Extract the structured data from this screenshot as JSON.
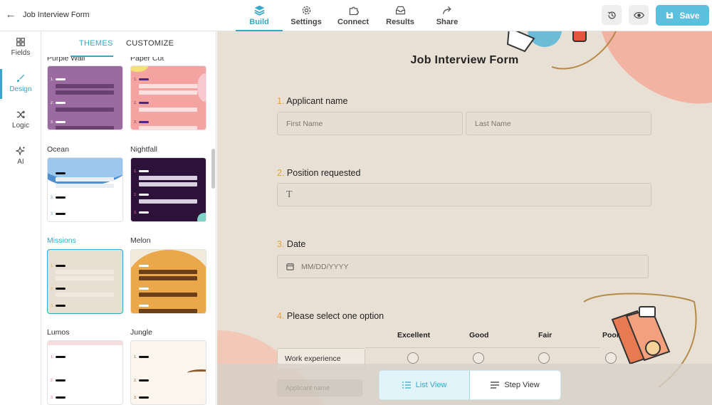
{
  "topbar": {
    "title": "Job Interview Form",
    "nav": [
      {
        "label": "Build",
        "icon": "stack-icon",
        "active": true
      },
      {
        "label": "Settings",
        "icon": "gear-icon",
        "active": false
      },
      {
        "label": "Connect",
        "icon": "puzzle-icon",
        "active": false
      },
      {
        "label": "Results",
        "icon": "inbox-icon",
        "active": false
      },
      {
        "label": "Share",
        "icon": "share-arrow-icon",
        "active": false
      }
    ],
    "save_label": "Save"
  },
  "rail": [
    {
      "label": "Fields",
      "icon": "grid-icon"
    },
    {
      "label": "Design",
      "icon": "brush-icon",
      "active": true
    },
    {
      "label": "Logic",
      "icon": "shuffle-icon"
    },
    {
      "label": "AI",
      "icon": "sparkle-icon"
    }
  ],
  "panel": {
    "tabs": {
      "themes": "THEMES",
      "customize": "CUSTOMIZE"
    },
    "themes": [
      {
        "name": "Purple Wall"
      },
      {
        "name": "Paper Cut"
      },
      {
        "name": "Ocean"
      },
      {
        "name": "Nightfall"
      },
      {
        "name": "Missions",
        "selected": true
      },
      {
        "name": "Melon"
      },
      {
        "name": "Lumos"
      },
      {
        "name": "Jungle"
      }
    ],
    "thumb_numbers": [
      "1.",
      "2.",
      "3."
    ]
  },
  "form": {
    "title": "Job Interview Form",
    "q1": {
      "num": "1.",
      "label": "Applicant name",
      "first_placeholder": "First Name",
      "last_placeholder": "Last Name"
    },
    "q2": {
      "num": "2.",
      "label": "Position requested",
      "placeholder": "T"
    },
    "q3": {
      "num": "3.",
      "label": "Date",
      "placeholder": "MM/DD/YYYY"
    },
    "q4": {
      "num": "4.",
      "label": "Please select one option",
      "columns": [
        "Excellent",
        "Good",
        "Fair",
        "Poor"
      ],
      "rows": [
        "Work experience"
      ]
    },
    "ghost_field": "Applicant name"
  },
  "view_toggle": {
    "list": "List View",
    "step": "Step View"
  },
  "colors": {
    "accent": "#36a7c6",
    "save": "#5bc0de",
    "canvas": "#e8e0d5",
    "question_number": "#e8a23c"
  }
}
